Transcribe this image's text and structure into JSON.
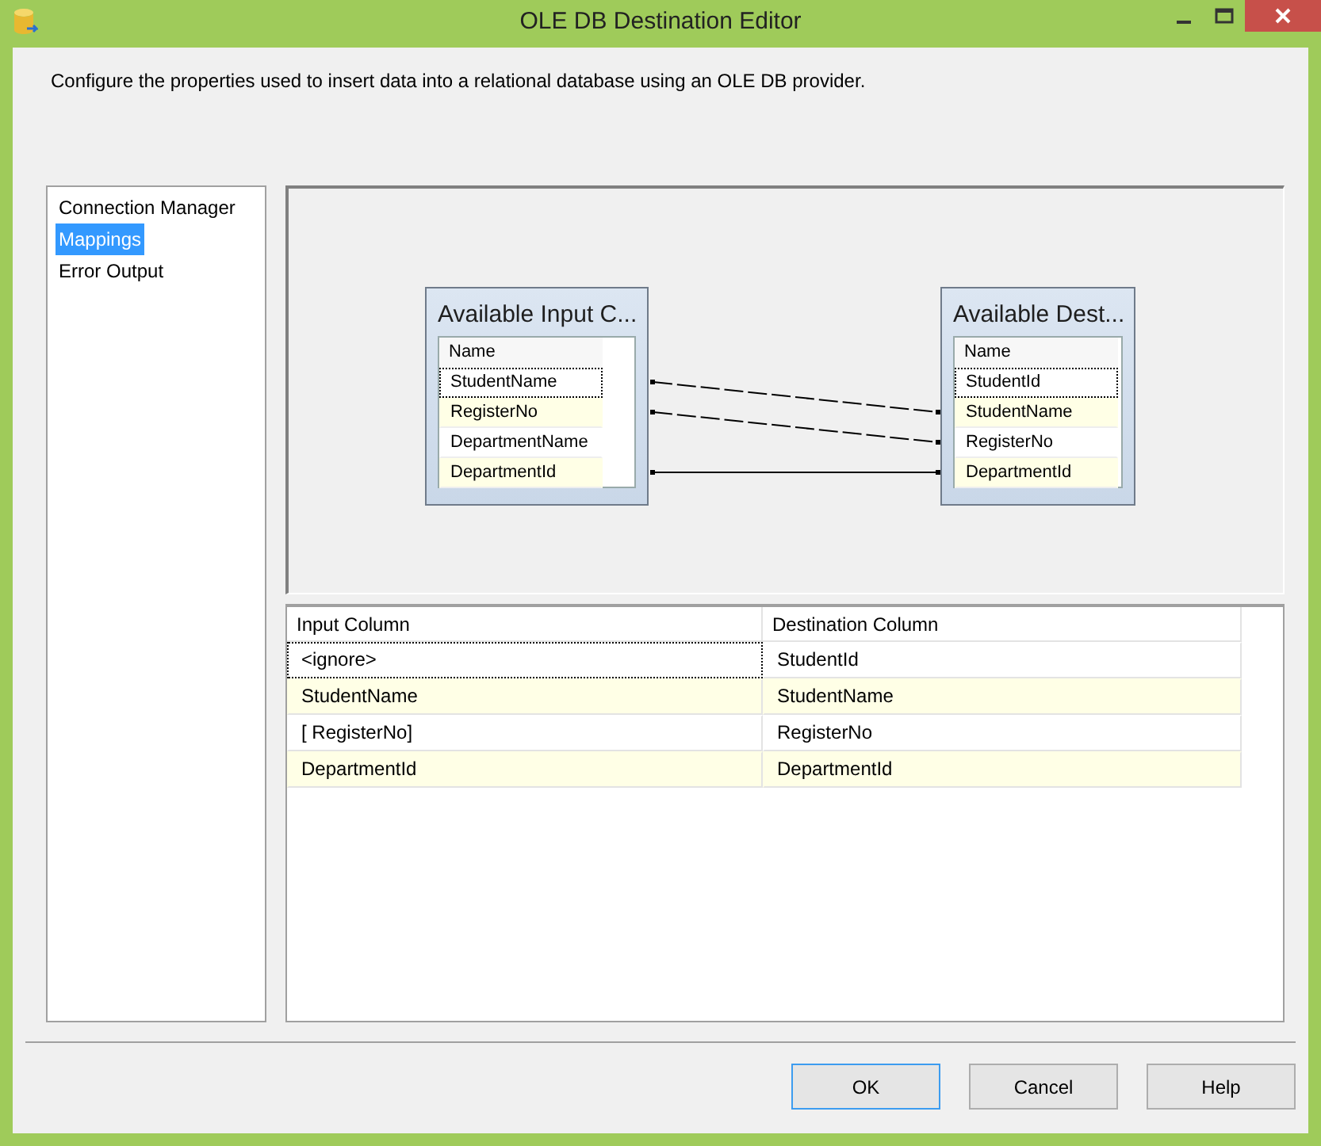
{
  "window": {
    "title": "OLE DB Destination Editor"
  },
  "description": "Configure the properties used to insert data into a relational database using an OLE DB provider.",
  "sidebar": {
    "items": [
      {
        "label": "Connection Manager",
        "selected": false
      },
      {
        "label": "Mappings",
        "selected": true
      },
      {
        "label": "Error Output",
        "selected": false
      }
    ]
  },
  "diagram": {
    "input_table": {
      "title": "Available Input C...",
      "header": "Name",
      "rows": [
        {
          "name": "StudentName",
          "focused": true,
          "mapped": true
        },
        {
          "name": "RegisterNo",
          "focused": false,
          "mapped": true
        },
        {
          "name": "DepartmentName",
          "focused": false,
          "mapped": false
        },
        {
          "name": "DepartmentId",
          "focused": false,
          "mapped": true
        }
      ]
    },
    "destination_table": {
      "title": "Available Dest...",
      "header": "Name",
      "rows": [
        {
          "name": "StudentId",
          "focused": true,
          "mapped": false
        },
        {
          "name": "StudentName",
          "focused": false,
          "mapped": true
        },
        {
          "name": "RegisterNo",
          "focused": false,
          "mapped": true
        },
        {
          "name": "DepartmentId",
          "focused": false,
          "mapped": true
        }
      ]
    },
    "links": [
      {
        "dashed": true
      },
      {
        "dashed": true
      },
      {
        "dashed": false
      }
    ]
  },
  "mapping_table": {
    "columns": [
      "Input Column",
      "Destination Column"
    ],
    "rows": [
      {
        "input": "<ignore>",
        "destination": "StudentId",
        "focused": true
      },
      {
        "input": "StudentName",
        "destination": "StudentName",
        "focused": false
      },
      {
        "input": "[ RegisterNo]",
        "destination": "RegisterNo",
        "focused": false
      },
      {
        "input": "DepartmentId",
        "destination": "DepartmentId",
        "focused": false
      }
    ]
  },
  "buttons": [
    {
      "label": "OK",
      "default": true
    },
    {
      "label": "Cancel",
      "default": false
    },
    {
      "label": "Help",
      "default": false
    }
  ]
}
